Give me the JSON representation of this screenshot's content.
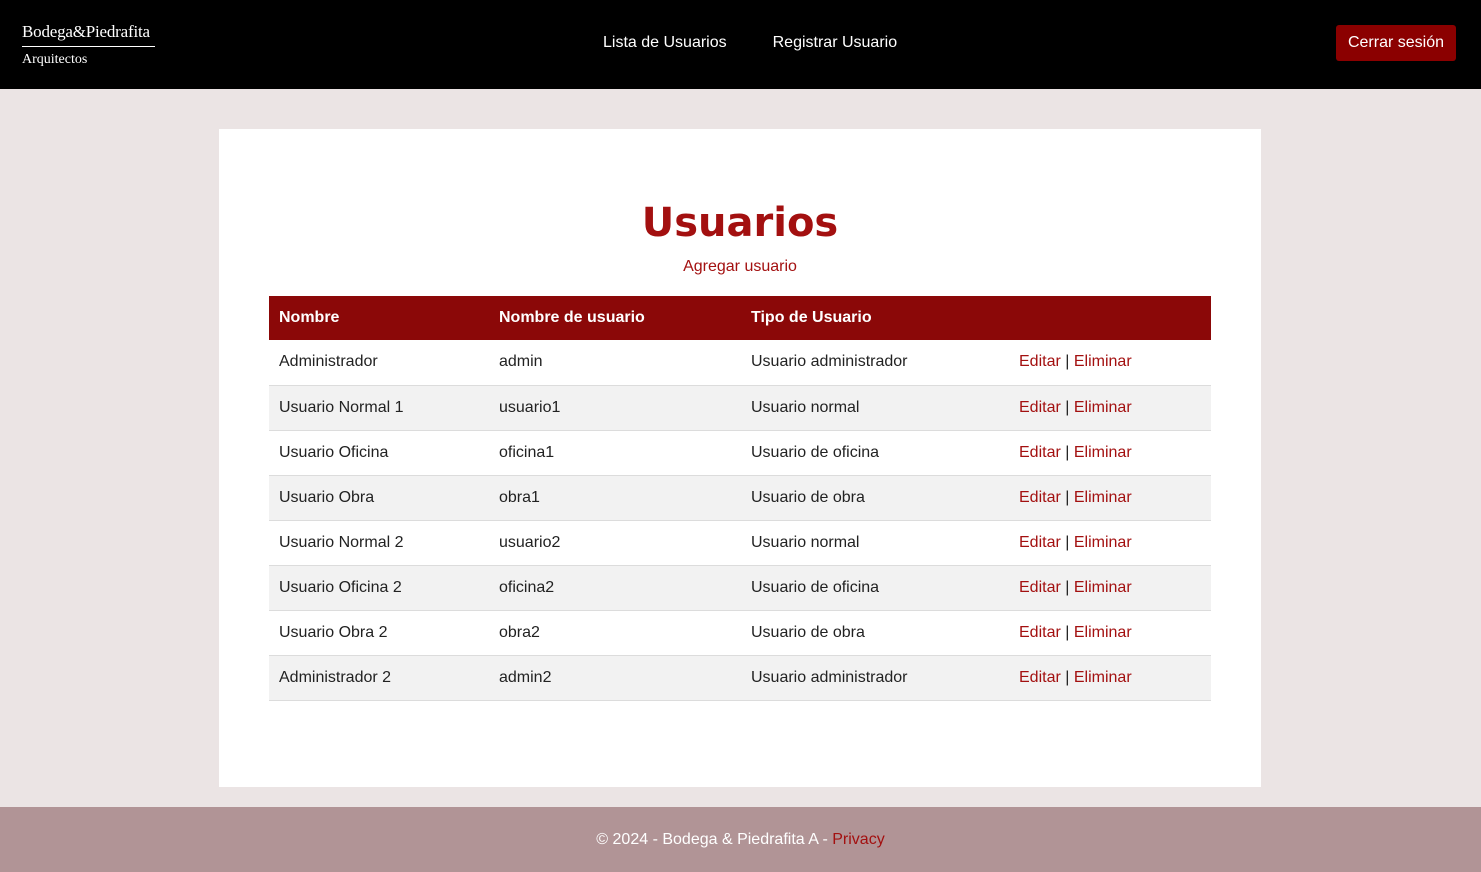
{
  "header": {
    "logo_main": "Bodega&Piedrafita",
    "logo_sub": "Arquitectos",
    "nav": [
      "Lista de Usuarios",
      "Registrar Usuario"
    ],
    "logout_label": "Cerrar sesión"
  },
  "main": {
    "title": "Usuarios",
    "add_link": "Agregar usuario",
    "columns": [
      "Nombre",
      "Nombre de usuario",
      "Tipo de Usuario",
      ""
    ],
    "edit_label": "Editar",
    "separator": "|",
    "delete_label": "Eliminar",
    "rows": [
      {
        "name": "Administrador",
        "username": "admin",
        "type": "Usuario administrador"
      },
      {
        "name": "Usuario Normal 1",
        "username": "usuario1",
        "type": "Usuario normal"
      },
      {
        "name": "Usuario Oficina",
        "username": "oficina1",
        "type": "Usuario de oficina"
      },
      {
        "name": "Usuario Obra",
        "username": "obra1",
        "type": "Usuario de obra"
      },
      {
        "name": "Usuario Normal 2",
        "username": "usuario2",
        "type": "Usuario normal"
      },
      {
        "name": "Usuario Oficina 2",
        "username": "oficina2",
        "type": "Usuario de oficina"
      },
      {
        "name": "Usuario Obra 2",
        "username": "obra2",
        "type": "Usuario de obra"
      },
      {
        "name": "Administrador 2",
        "username": "admin2",
        "type": "Usuario administrador"
      }
    ]
  },
  "footer": {
    "text": "© 2024 - Bodega & Piedrafita A - ",
    "privacy": "Privacy"
  },
  "colors": {
    "accent": "#8b0000",
    "title": "#a31010",
    "footer_bg": "#b19496",
    "page_bg": "#ebe4e4"
  }
}
